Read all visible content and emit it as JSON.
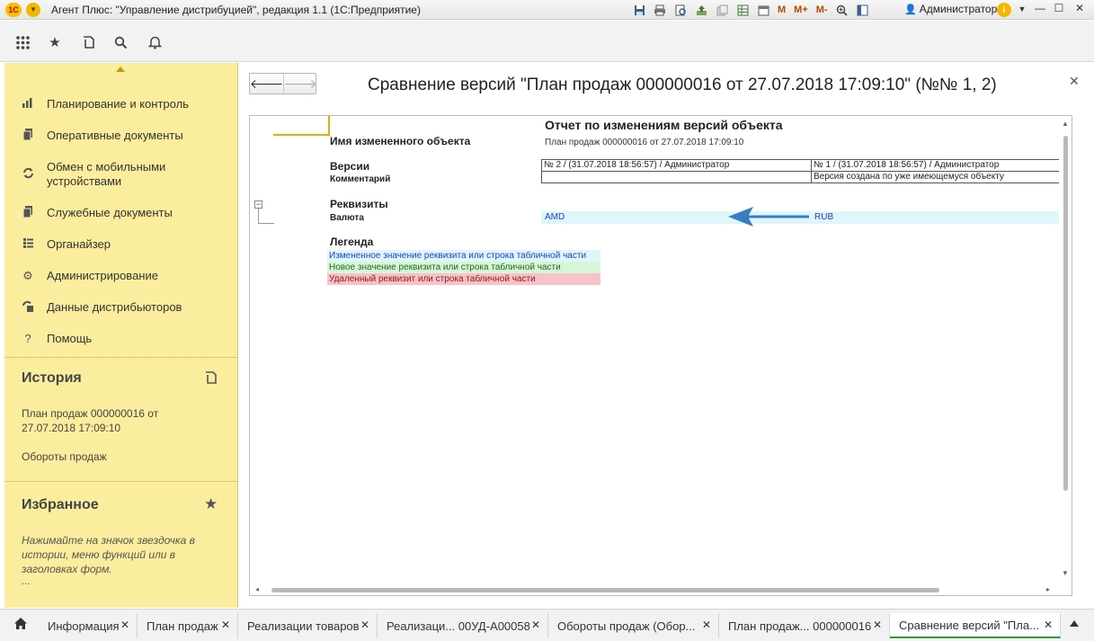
{
  "window": {
    "logo": "1С",
    "title": "Агент Плюс: \"Управление дистрибуцией\", редакция 1.1  (1С:Предприятие)",
    "user": "Администратор",
    "tools": [
      "save-icon",
      "print-icon",
      "preview-icon",
      "upload-icon",
      "copy-icon",
      "table-icon",
      "calendar-icon"
    ],
    "m_buttons": [
      "M",
      "M+",
      "M-"
    ]
  },
  "toolbar": {
    "icons": [
      "apps-grid-icon",
      "star-icon",
      "history-icon",
      "search-icon",
      "bell-icon"
    ]
  },
  "sidebar": {
    "items": [
      {
        "label": "Планирование и контроль",
        "icon": "chart-icon"
      },
      {
        "label": "Оперативные документы",
        "icon": "documents-icon"
      },
      {
        "label": "Обмен с мобильными устройствами",
        "icon": "sync-icon"
      },
      {
        "label": "Служебные документы",
        "icon": "service-docs-icon"
      },
      {
        "label": "Органайзер",
        "icon": "organizer-icon"
      },
      {
        "label": "Администрирование",
        "icon": "gear-icon"
      },
      {
        "label": "Данные дистрибьюторов",
        "icon": "distributors-icon"
      },
      {
        "label": "Помощь",
        "icon": "help-icon"
      }
    ],
    "history": {
      "title": "История",
      "items": [
        "План продаж 000000016 от 27.07.2018 17:09:10",
        "Обороты продаж"
      ]
    },
    "favorites": {
      "title": "Избранное",
      "hint": "Нажимайте на значок звездочка в истории, меню функций или в заголовках форм.",
      "ellipsis": "..."
    }
  },
  "form": {
    "title": "Сравнение версий \"План продаж 000000016 от 27.07.2018 17:09:10\" (№№ 1, 2)",
    "report": {
      "title": "Отчет по изменениям версий объекта",
      "object_label": "Имя измененного объекта",
      "object_value": "План продаж 000000016 от 27.07.2018 17:09:10",
      "versions_label": "Версии",
      "comment_label": "Комментарий",
      "version_a": "№ 2 / (31.07.2018 18:56:57) / Администратор",
      "version_b": "№ 1 / (31.07.2018 18:56:57) / Администратор",
      "comment_a": "",
      "comment_b": "Версия создана по уже имеющемуся объекту",
      "attrs_label": "Реквизиты",
      "attr_name": "Валюта",
      "attr_value_a": "AMD",
      "attr_value_b": "RUB",
      "legend_label": "Легенда",
      "legend": [
        {
          "text": "Измененное значение реквизита или строка табличной части",
          "color": "#1a3fd6",
          "bg": "#dff6fb"
        },
        {
          "text": "Новое значение реквизита или строка табличной части",
          "color": "#1f6b1f",
          "bg": "#d7f5d7"
        },
        {
          "text": "Удаленный реквизит или строка табличной части",
          "color": "#8b1a1a",
          "bg": "#f7c3c8"
        }
      ]
    }
  },
  "tabs": [
    {
      "label": "Информация"
    },
    {
      "label": "План продаж"
    },
    {
      "label": "Реализации товаров"
    },
    {
      "label": "Реализаци... 00УД-А00058"
    },
    {
      "label": "Обороты продаж (Обор..."
    },
    {
      "label": "План продаж... 000000016"
    },
    {
      "label": "Сравнение версий \"Пла..."
    }
  ],
  "colors": {
    "sidebar_bg": "#fbed9e",
    "active_tab_underline": "#2e9b3b",
    "arrow": "#3b7dc4",
    "link_blue": "#1a3fd6"
  }
}
